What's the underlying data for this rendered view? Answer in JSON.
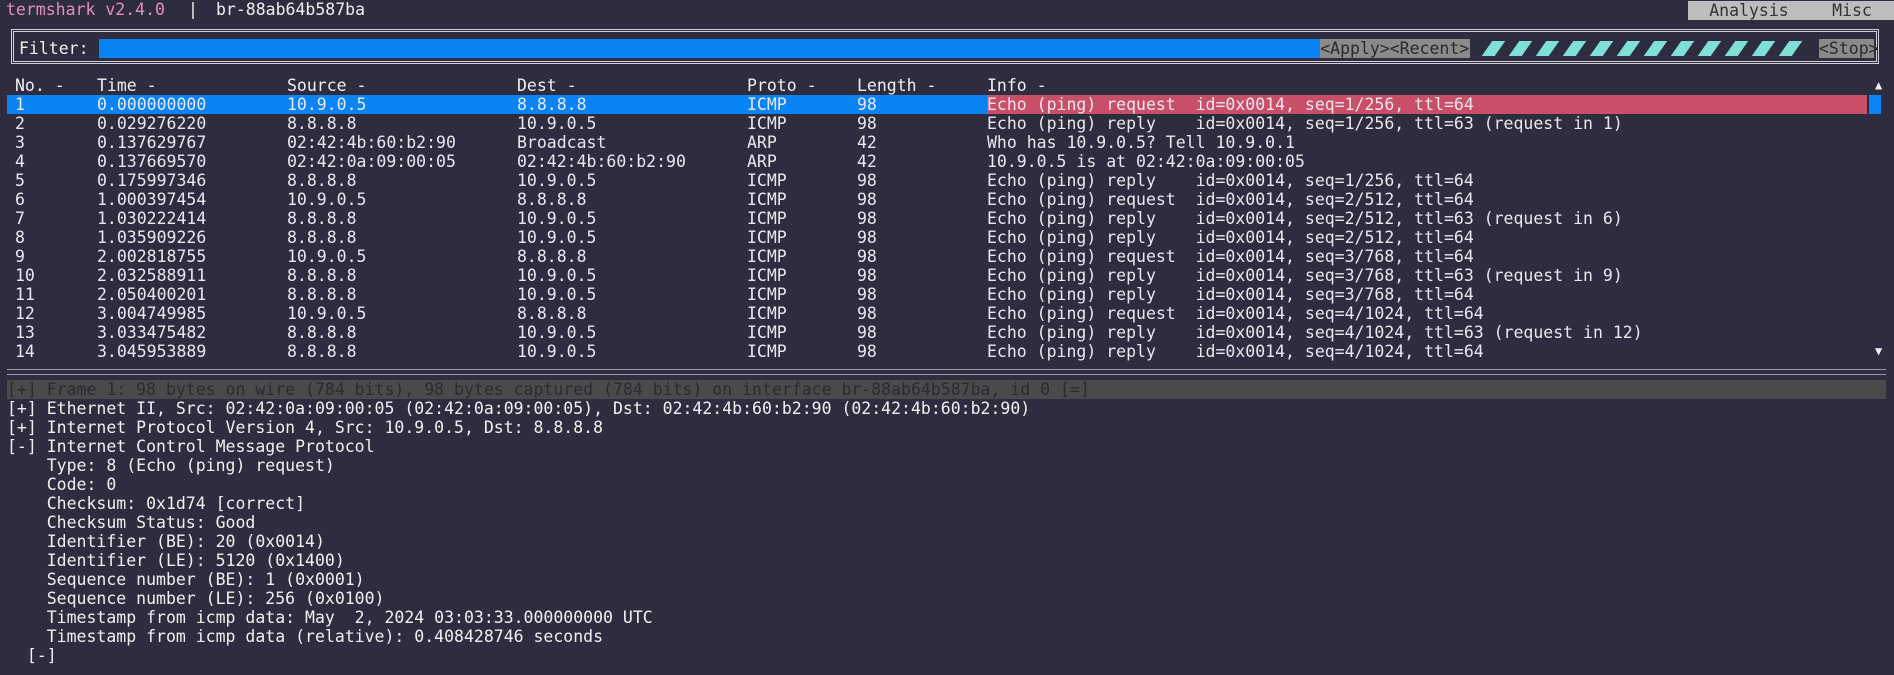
{
  "titlebar": {
    "app_name": "termshark v2.4.0",
    "separator": "|",
    "interface": "br-88ab64b587ba",
    "menu": [
      "Analysis",
      "Misc"
    ]
  },
  "filter": {
    "label": "Filter:",
    "value": "",
    "apply_label": "<Apply>",
    "recent_label": "<Recent>",
    "stop_label": "<Stop>"
  },
  "packet_list": {
    "columns": [
      "No. -",
      "Time -",
      "Source -",
      "Dest -",
      "Proto -",
      "Length -",
      "Info -"
    ],
    "rows": [
      [
        "1",
        "0.000000000",
        "10.9.0.5",
        "8.8.8.8",
        "ICMP",
        "98",
        "Echo (ping) request  id=0x0014, seq=1/256, ttl=64"
      ],
      [
        "2",
        "0.029276220",
        "8.8.8.8",
        "10.9.0.5",
        "ICMP",
        "98",
        "Echo (ping) reply    id=0x0014, seq=1/256, ttl=63 (request in 1)"
      ],
      [
        "3",
        "0.137629767",
        "02:42:4b:60:b2:90",
        "Broadcast",
        "ARP",
        "42",
        "Who has 10.9.0.5? Tell 10.9.0.1"
      ],
      [
        "4",
        "0.137669570",
        "02:42:0a:09:00:05",
        "02:42:4b:60:b2:90",
        "ARP",
        "42",
        "10.9.0.5 is at 02:42:0a:09:00:05"
      ],
      [
        "5",
        "0.175997346",
        "8.8.8.8",
        "10.9.0.5",
        "ICMP",
        "98",
        "Echo (ping) reply    id=0x0014, seq=1/256, ttl=64"
      ],
      [
        "6",
        "1.000397454",
        "10.9.0.5",
        "8.8.8.8",
        "ICMP",
        "98",
        "Echo (ping) request  id=0x0014, seq=2/512, ttl=64"
      ],
      [
        "7",
        "1.030222414",
        "8.8.8.8",
        "10.9.0.5",
        "ICMP",
        "98",
        "Echo (ping) reply    id=0x0014, seq=2/512, ttl=63 (request in 6)"
      ],
      [
        "8",
        "1.035909226",
        "8.8.8.8",
        "10.9.0.5",
        "ICMP",
        "98",
        "Echo (ping) reply    id=0x0014, seq=2/512, ttl=64"
      ],
      [
        "9",
        "2.002818755",
        "10.9.0.5",
        "8.8.8.8",
        "ICMP",
        "98",
        "Echo (ping) request  id=0x0014, seq=3/768, ttl=64"
      ],
      [
        "10",
        "2.032588911",
        "8.8.8.8",
        "10.9.0.5",
        "ICMP",
        "98",
        "Echo (ping) reply    id=0x0014, seq=3/768, ttl=63 (request in 9)"
      ],
      [
        "11",
        "2.050400201",
        "8.8.8.8",
        "10.9.0.5",
        "ICMP",
        "98",
        "Echo (ping) reply    id=0x0014, seq=3/768, ttl=64"
      ],
      [
        "12",
        "3.004749985",
        "10.9.0.5",
        "8.8.8.8",
        "ICMP",
        "98",
        "Echo (ping) request  id=0x0014, seq=4/1024, ttl=64"
      ],
      [
        "13",
        "3.033475482",
        "8.8.8.8",
        "10.9.0.5",
        "ICMP",
        "98",
        "Echo (ping) reply    id=0x0014, seq=4/1024, ttl=63 (request in 12)"
      ],
      [
        "14",
        "3.045953889",
        "8.8.8.8",
        "10.9.0.5",
        "ICMP",
        "98",
        "Echo (ping) reply    id=0x0014, seq=4/1024, ttl=64"
      ]
    ],
    "scroll_up": "▲",
    "scroll_down": "▼"
  },
  "details": {
    "lines": [
      "[+] Frame 1: 98 bytes on wire (784 bits), 98 bytes captured (784 bits) on interface br-88ab64b587ba, id 0 [=]",
      "[+] Ethernet II, Src: 02:42:0a:09:00:05 (02:42:0a:09:00:05), Dst: 02:42:4b:60:b2:90 (02:42:4b:60:b2:90)",
      "[+] Internet Protocol Version 4, Src: 10.9.0.5, Dst: 8.8.8.8",
      "[-] Internet Control Message Protocol",
      "    Type: 8 (Echo (ping) request)",
      "    Code: 0",
      "    Checksum: 0x1d74 [correct]",
      "    Checksum Status: Good",
      "    Identifier (BE): 20 (0x0014)",
      "    Identifier (LE): 5120 (0x1400)",
      "    Sequence number (BE): 1 (0x0001)",
      "    Sequence number (LE): 256 (0x0100)",
      "    Timestamp from icmp data: May  2, 2024 03:03:33.000000000 UTC",
      "    Timestamp from icmp data (relative): 0.408428746 seconds",
      "  [-]"
    ]
  },
  "colors": {
    "background": "#2e2c3f",
    "selection": "#0a84f5",
    "selected_info": "#c94f68",
    "app_name": "#e68fb5",
    "progress": "#7ee0d6"
  }
}
